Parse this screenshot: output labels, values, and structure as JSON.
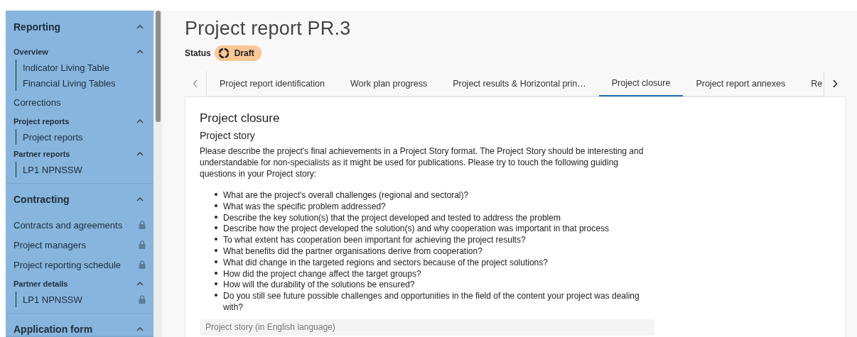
{
  "sidebar": {
    "sections": [
      {
        "title": "Reporting",
        "expanded": true,
        "items": [
          {
            "kind": "group",
            "label": "Overview",
            "expanded": true,
            "children": [
              {
                "label": "Indicator Living Table",
                "locked": false
              },
              {
                "label": "Financial Living Tables",
                "locked": false
              }
            ]
          },
          {
            "kind": "link",
            "label": "Corrections",
            "locked": false
          },
          {
            "kind": "group",
            "label": "Project reports",
            "expanded": true,
            "children": [
              {
                "label": "Project reports",
                "locked": false
              }
            ]
          },
          {
            "kind": "group",
            "label": "Partner reports",
            "expanded": true,
            "children": [
              {
                "label": "LP1 NPNSSW",
                "locked": false
              }
            ]
          }
        ]
      },
      {
        "title": "Contracting",
        "expanded": true,
        "items": [
          {
            "kind": "link",
            "label": "Contracts and agreements",
            "locked": true
          },
          {
            "kind": "link",
            "label": "Project managers",
            "locked": true
          },
          {
            "kind": "link",
            "label": "Project reporting schedule",
            "locked": true
          },
          {
            "kind": "group",
            "label": "Partner details",
            "expanded": true,
            "children": [
              {
                "label": "LP1 NPNSSW",
                "locked": true
              }
            ]
          }
        ]
      },
      {
        "title": "Application form",
        "expanded": true
      }
    ]
  },
  "page": {
    "title": "Project report PR.3",
    "status_label": "Status",
    "status": "Draft"
  },
  "tabs": [
    {
      "label": "Project report identification",
      "selected": false
    },
    {
      "label": "Work plan progress",
      "selected": false
    },
    {
      "label": "Project results & Horizontal prin…",
      "selected": false
    },
    {
      "label": "Project closure",
      "selected": true
    },
    {
      "label": "Project report annexes",
      "selected": false
    },
    {
      "label": "Re",
      "selected": false
    }
  ],
  "card": {
    "title": "Project closure",
    "subtitle": "Project story",
    "description": "Please describe the project's final achievements in a Project Story format. The Project Story should be interesting and understandable for non-specialists as it might be used for publications. Please try to touch the following guiding questions in your Project story:",
    "questions": [
      "What are the project's overall challenges (regional and sectoral)?",
      "What was the specific problem addressed?",
      "Describe the key solution(s) that the project developed and tested to address the problem",
      "Describe how the project developed the solution(s) and why cooperation was important in that process",
      "To what extent has cooperation been important for achieving the project results?",
      "What benefits did the partner organisations derive from cooperation?",
      "What did change in the targeted regions and sectors because of the project solutions?",
      "How did the project change affect the target groups?",
      "How will the durability of the solutions be ensured?",
      "Do you still see future possible challenges and opportunities in the field of the content your project was dealing with?"
    ],
    "field": {
      "placeholder": "Project story (in English language)"
    }
  }
}
